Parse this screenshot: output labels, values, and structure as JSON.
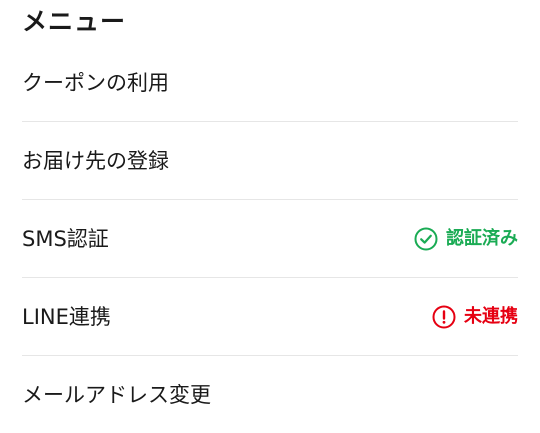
{
  "menu": {
    "title": "メニュー",
    "items": [
      {
        "label": "クーポンの利用"
      },
      {
        "label": "お届け先の登録"
      },
      {
        "label": "SMS認証",
        "status": {
          "text": "認証済み",
          "icon": "check-circle-icon",
          "color": "#1aab54"
        }
      },
      {
        "label": "LINE連携",
        "status": {
          "text": "未連携",
          "icon": "exclamation-circle-icon",
          "color": "#e60012"
        }
      },
      {
        "label": "メールアドレス変更"
      }
    ]
  }
}
